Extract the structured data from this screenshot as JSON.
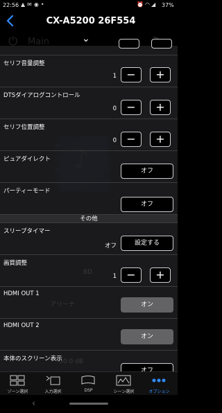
{
  "status_bar": {
    "time": "22:56",
    "left_icons": [
      "warning-icon",
      "mail-icon",
      "app-icon",
      "dot-icon"
    ],
    "right_icons": [
      "alarm-icon",
      "wifi-icon",
      "signal-icon"
    ],
    "battery": "37%"
  },
  "header": {
    "title": "CX-A5200 26F554"
  },
  "background": {
    "zone_label": "Main",
    "collapse_glyph": "⌄"
  },
  "rows": {
    "serif_volume": {
      "label": "セリフ音量調整",
      "value": "1",
      "minus": "−",
      "plus": "+"
    },
    "dts_dialog": {
      "label": "DTSダイアログコントロール",
      "value": "0",
      "minus": "−",
      "plus": "+"
    },
    "serif_position": {
      "label": "セリフ位置調整",
      "value": "0",
      "minus": "−",
      "plus": "+"
    },
    "pure_direct": {
      "label": "ピュアダイレクト",
      "button": "オフ"
    },
    "party_mode": {
      "label": "パーティーモード",
      "button": "オフ"
    },
    "section_other": "その他",
    "sleep_timer": {
      "label": "スリープタイマー",
      "value": "オフ",
      "button": "設定する"
    },
    "picture_adjust": {
      "label": "画質調整",
      "value": "1",
      "minus": "−",
      "plus": "+"
    },
    "hdmi_out1": {
      "label": "HDMI OUT 1",
      "button": "オン"
    },
    "hdmi_out2": {
      "label": "HDMI OUT 2",
      "button": "オン"
    },
    "screen_display": {
      "label": "本体のスクリーン表示",
      "button": "オフ"
    }
  },
  "ghost_text": {
    "ghost1": "BD",
    "ghost2": "アリーナ",
    "ghost3": "-50.0 dB"
  },
  "nav": {
    "items": [
      {
        "label": "ゾーン選択",
        "icon": "zone-icon"
      },
      {
        "label": "入力選択",
        "icon": "input-icon"
      },
      {
        "label": "DSP",
        "icon": "dsp-icon"
      },
      {
        "label": "シーン選択",
        "icon": "scene-icon"
      },
      {
        "label": "オプション",
        "icon": "options-icon",
        "active": true
      }
    ]
  },
  "colors": {
    "accent": "#2e8cff",
    "row_bg": "#1c1c1e",
    "section_bg": "#2c2c2e",
    "on_button": "#636366"
  }
}
